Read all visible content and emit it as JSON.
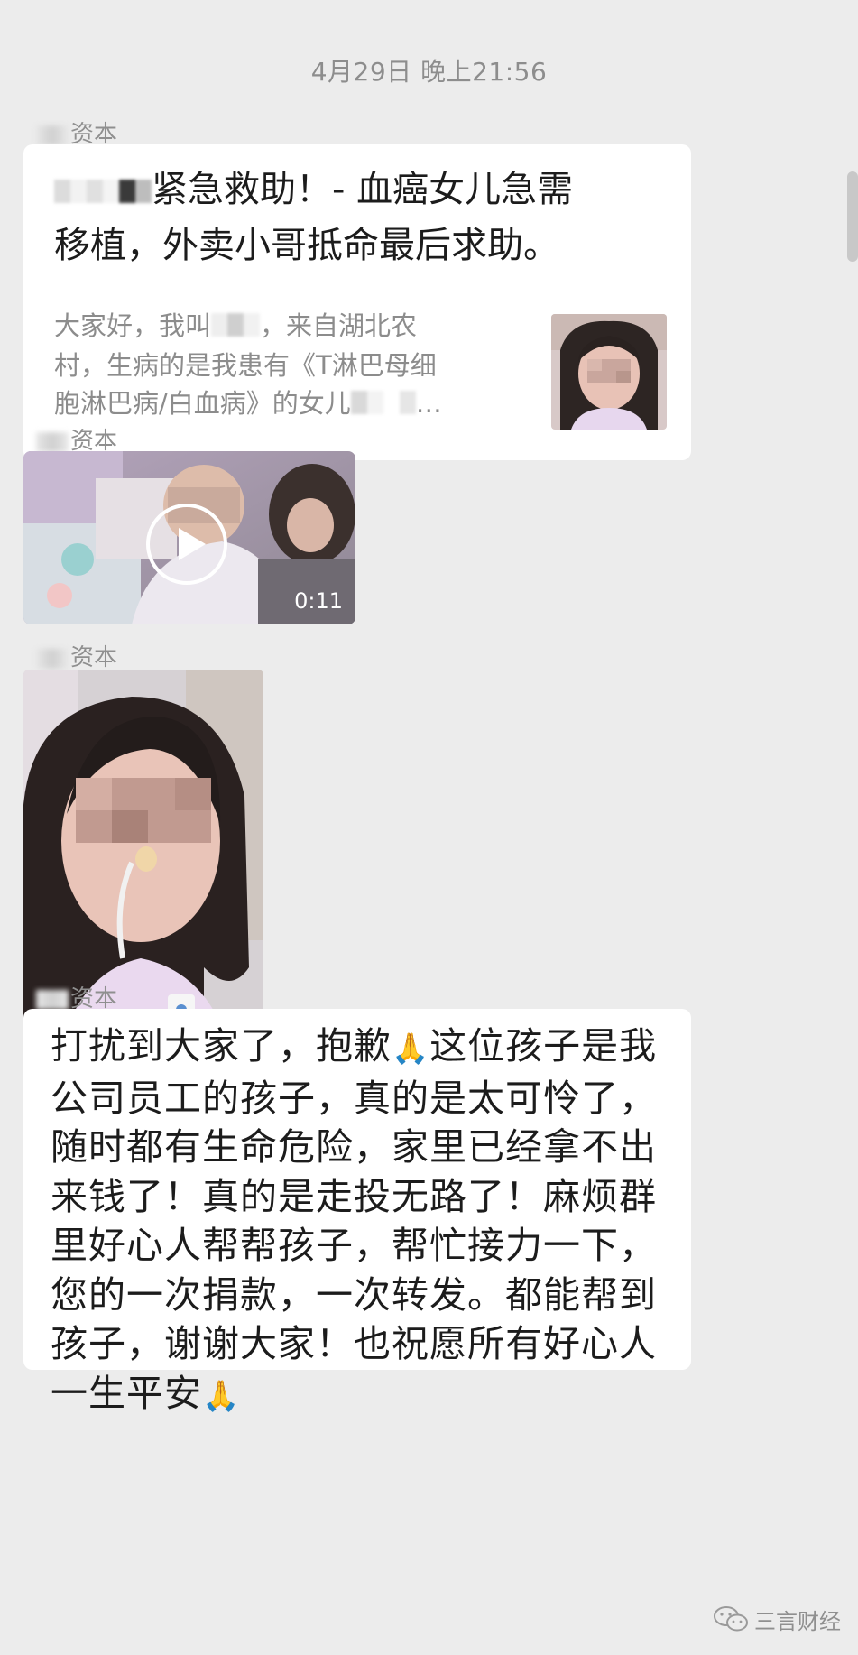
{
  "timestamp": "4月29日 晚上21:56",
  "messages": [
    {
      "sender": "资本",
      "type": "link_card",
      "title_line1": "紧急救助！- 血癌女儿急需",
      "title_line2": "移植，外卖小哥抵命最后求助。",
      "desc_line1a": "大家好，我叫",
      "desc_line1b": "，来自湖北农",
      "desc_line2": "村，生病的是我患有《T淋巴母细",
      "desc_line3a": "胞淋巴病/白血病》的女儿",
      "desc_line3b": "…",
      "thumbnail": "girl-photo-thumbnail"
    },
    {
      "sender": "资本",
      "type": "video",
      "duration": "0:11",
      "icon": "play-icon"
    },
    {
      "sender": "资本",
      "type": "image",
      "image": "girl-photo"
    },
    {
      "sender": "资本",
      "type": "text",
      "lines": [
        "打扰到大家了，抱歉",
        "公司员工的孩子，真的是太可怜了，",
        "随时都有生命危险，家里已经拿不出",
        "来钱了！真的是走投无路了！麻烦群",
        "里好心人帮帮孩子，帮忙接力一下，",
        "您的一次捐款，一次转发。都能帮到",
        "孩子，谢谢大家！也祝愿所有好心人",
        "一生平安"
      ],
      "line1_tail": "这位孩子是我",
      "emoji": "🙏"
    }
  ],
  "watermark": {
    "text": "三言财经",
    "icon": "wechat-logo-icon"
  },
  "colors": {
    "background": "#ececec",
    "bubble": "#ffffff",
    "muted_text": "#8d8d8d",
    "text": "#1c1c1c"
  }
}
